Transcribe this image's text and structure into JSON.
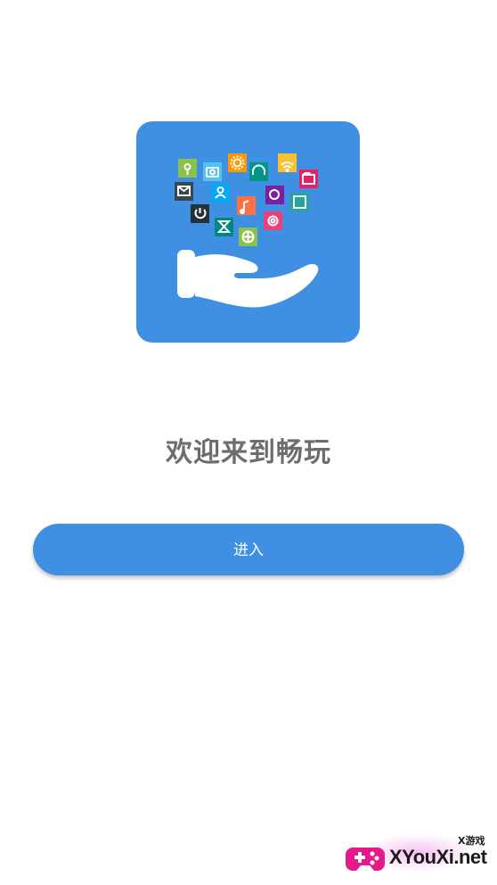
{
  "logo": {
    "background_color": "#3f8fe3",
    "icon_name": "hand-holding-apps-icon"
  },
  "welcome": {
    "title": "欢迎来到畅玩"
  },
  "enter_button": {
    "label": "进入",
    "color": "#3f8fe3"
  },
  "watermark": {
    "small_text": "X游戏",
    "site_text": "XYouXi.net"
  }
}
